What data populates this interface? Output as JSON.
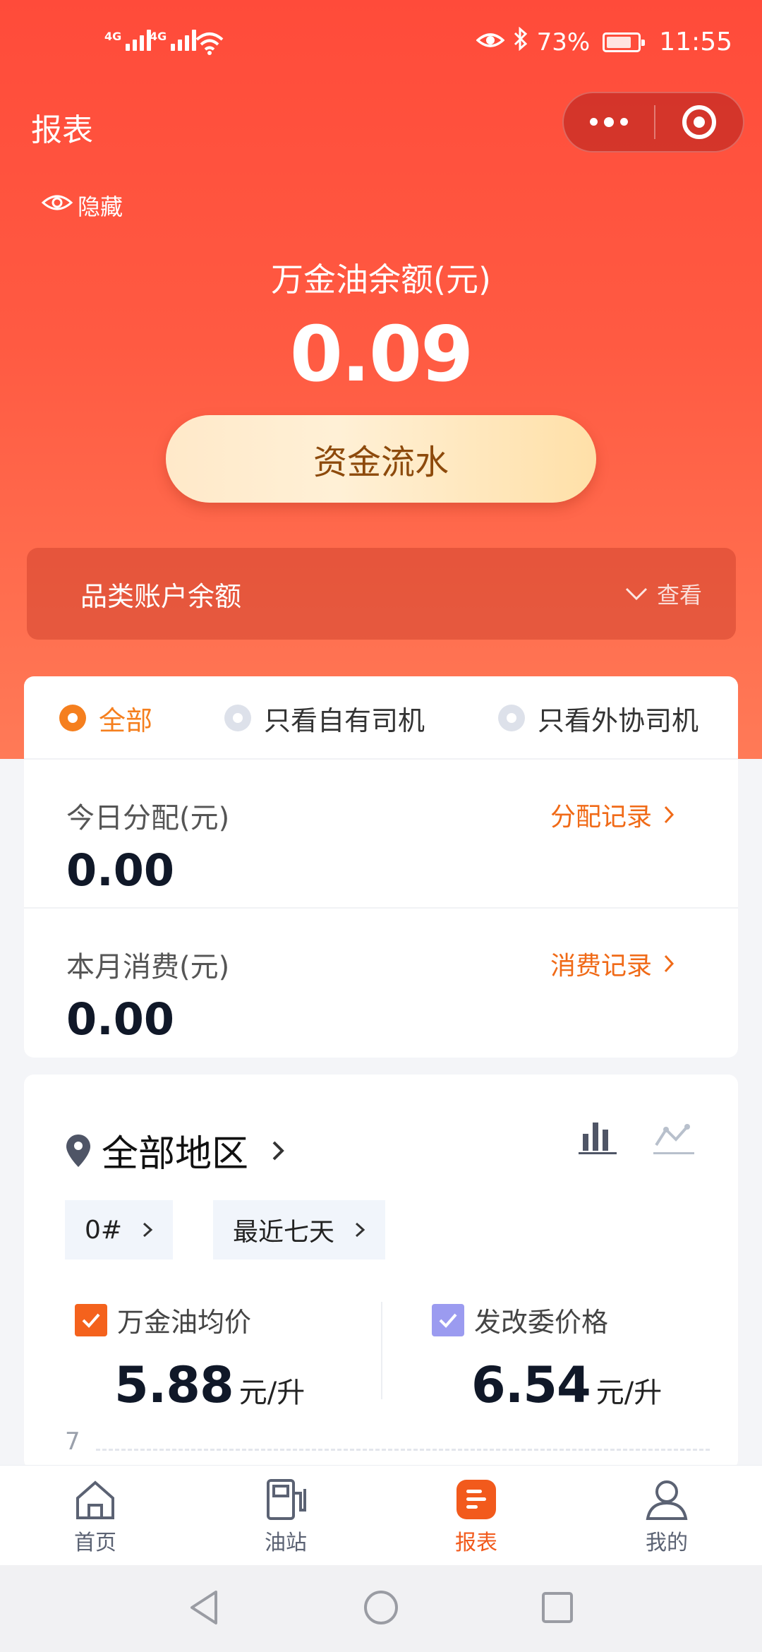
{
  "status": {
    "signal1": "4G",
    "signal2": "4G",
    "battery": "73%",
    "time": "11:55"
  },
  "header": {
    "title": "报表"
  },
  "balance": {
    "hide_label": "隐藏",
    "label": "万金油余额(元)",
    "value": "0.09",
    "flow_button": "资金流水"
  },
  "category": {
    "label": "品类账户余额",
    "view": "查看"
  },
  "filters": [
    {
      "label": "全部",
      "selected": true
    },
    {
      "label": "只看自有司机",
      "selected": false
    },
    {
      "label": "只看外协司机",
      "selected": false
    }
  ],
  "stats": {
    "today": {
      "title": "今日分配(元)",
      "value": "0.00",
      "link": "分配记录"
    },
    "month": {
      "title": "本月消费(元)",
      "value": "0.00",
      "link": "消费记录"
    }
  },
  "price_panel": {
    "region": "全部地区",
    "fuel": "0#",
    "period": "最近七天",
    "metrics": [
      {
        "label": "万金油均价",
        "value": "5.88",
        "unit": "元/升",
        "color": "#f4621d"
      },
      {
        "label": "发改委价格",
        "value": "6.54",
        "unit": "元/升",
        "color": "#9b9bf0"
      }
    ],
    "axis_top": "7"
  },
  "tabs": [
    {
      "label": "首页",
      "icon": "home-icon"
    },
    {
      "label": "油站",
      "icon": "gas-station-icon"
    },
    {
      "label": "报表",
      "icon": "report-icon",
      "active": true
    },
    {
      "label": "我的",
      "icon": "user-icon"
    }
  ],
  "colors": {
    "accent": "#f25a1c",
    "hero_top": "#ff4b3a",
    "link": "#f06a17"
  }
}
